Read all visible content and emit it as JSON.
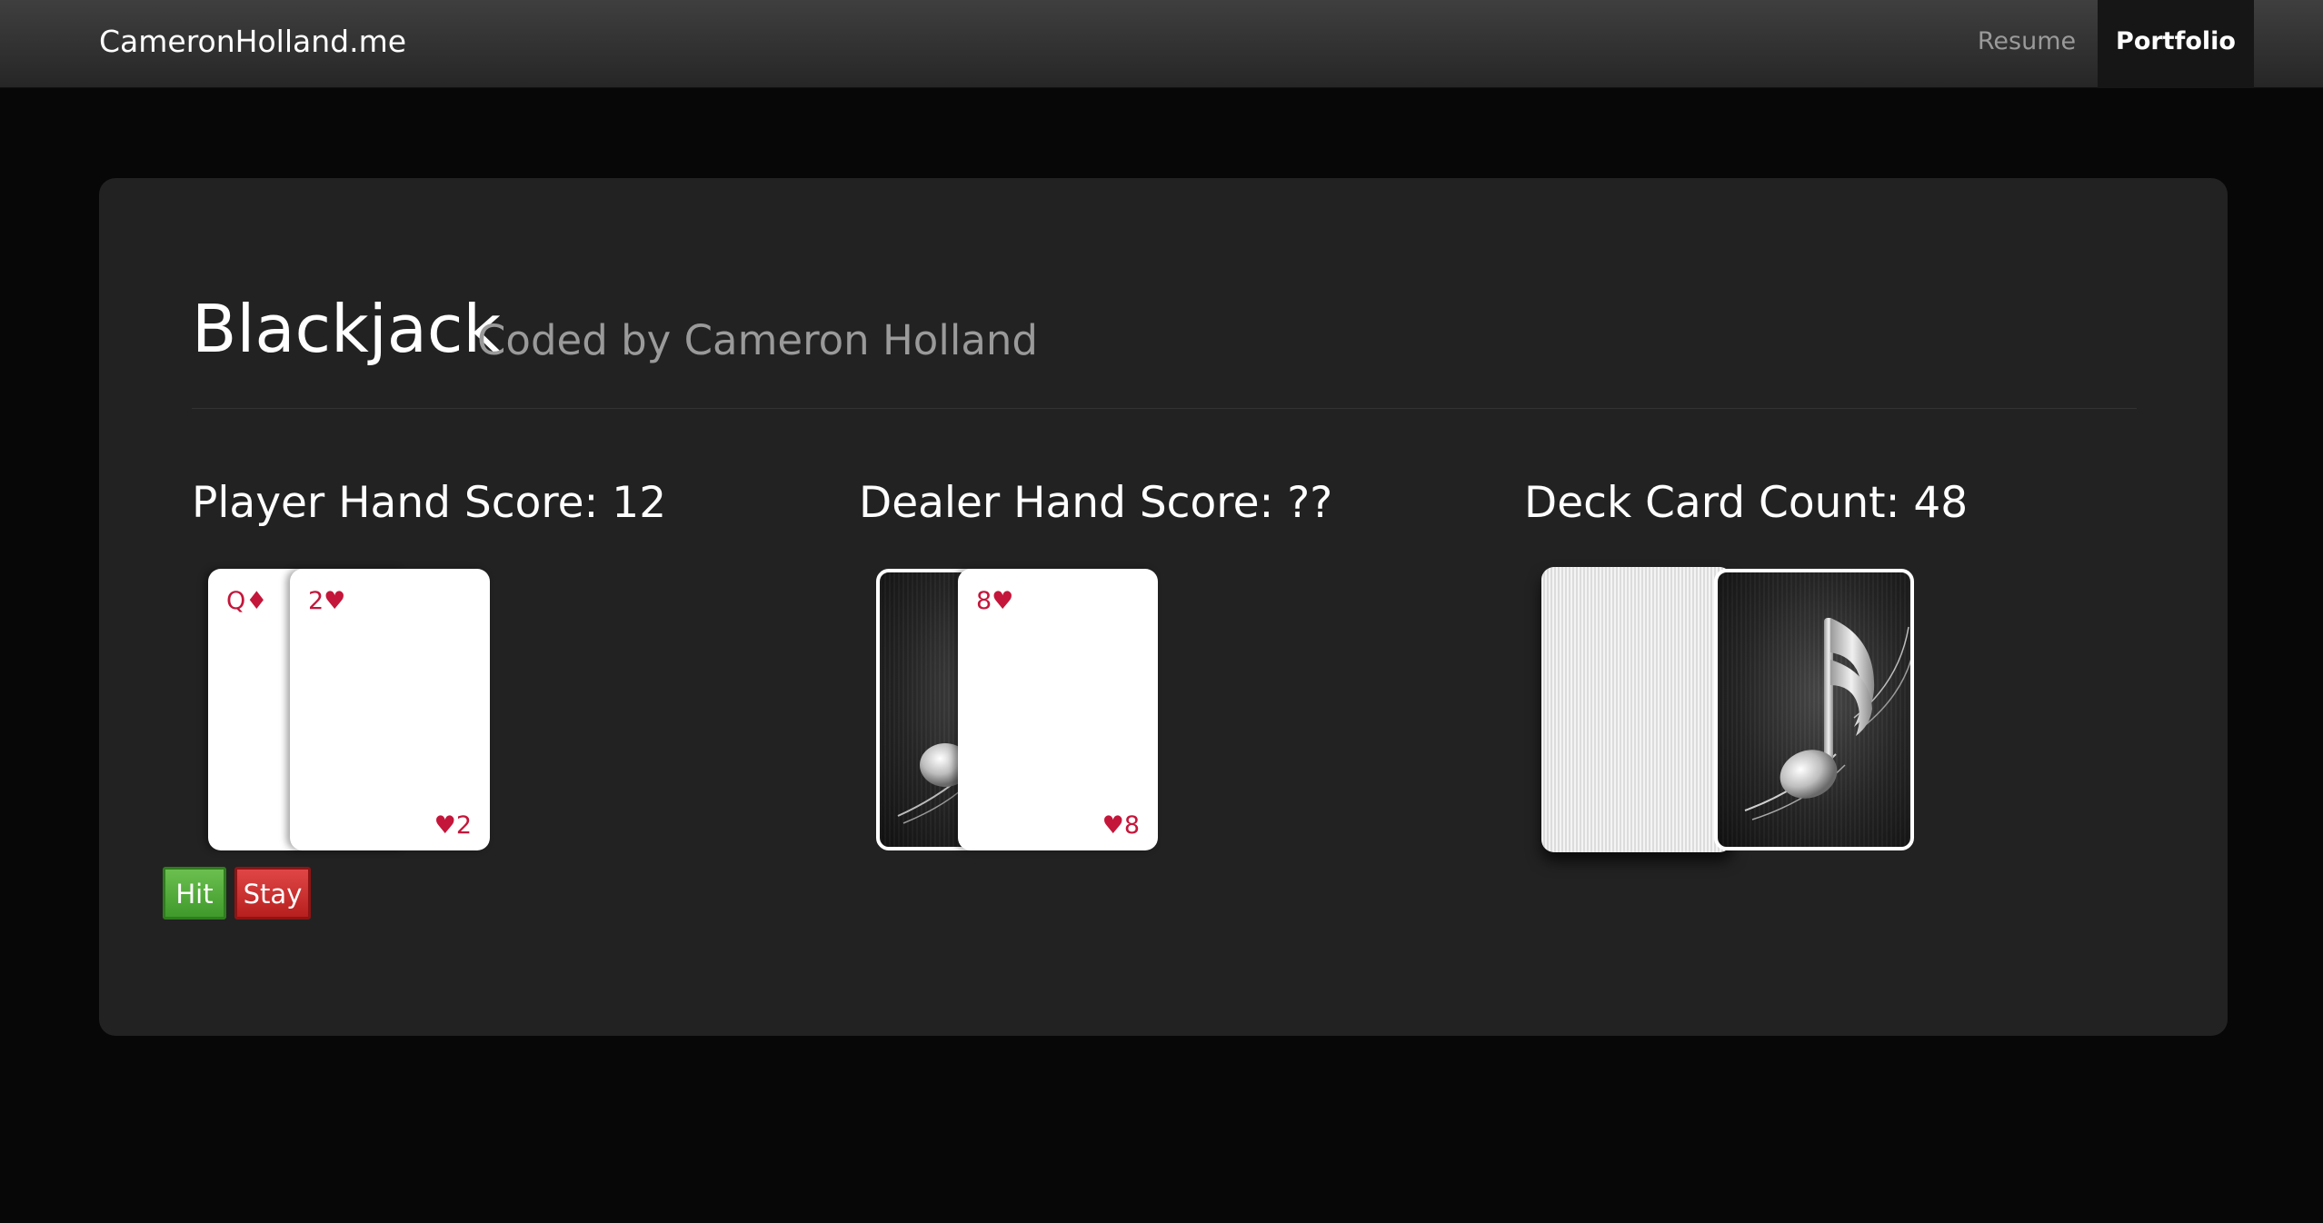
{
  "navbar": {
    "brand": "CameronHolland.me",
    "links": [
      {
        "label": "Resume",
        "active": false
      },
      {
        "label": "Portfolio",
        "active": true
      }
    ]
  },
  "header": {
    "title": "Blackjack",
    "subtitle": "Coded by Cameron Holland"
  },
  "player": {
    "score_label": "Player Hand Score: 12",
    "cards": [
      {
        "rank": "Q",
        "suit": "♦",
        "top": "Q♦",
        "bottom": ""
      },
      {
        "rank": "2",
        "suit": "♥",
        "top": "2♥",
        "bottom": "♥2"
      }
    ]
  },
  "dealer": {
    "score_label": "Dealer Hand Score: ??",
    "cards": [
      {
        "face_down": true
      },
      {
        "rank": "8",
        "suit": "♥",
        "top": "8♥",
        "bottom": "♥8"
      }
    ]
  },
  "deck": {
    "count_label": "Deck Card Count: 48"
  },
  "controls": {
    "hit_label": "Hit",
    "stay_label": "Stay"
  },
  "colors": {
    "background": "#070707",
    "panel": "#222222",
    "suit_red": "#c4163a",
    "hit_green": "#4fa83a",
    "stay_red": "#c92e2e"
  },
  "icons": {
    "card_back": "music-note-icon"
  }
}
